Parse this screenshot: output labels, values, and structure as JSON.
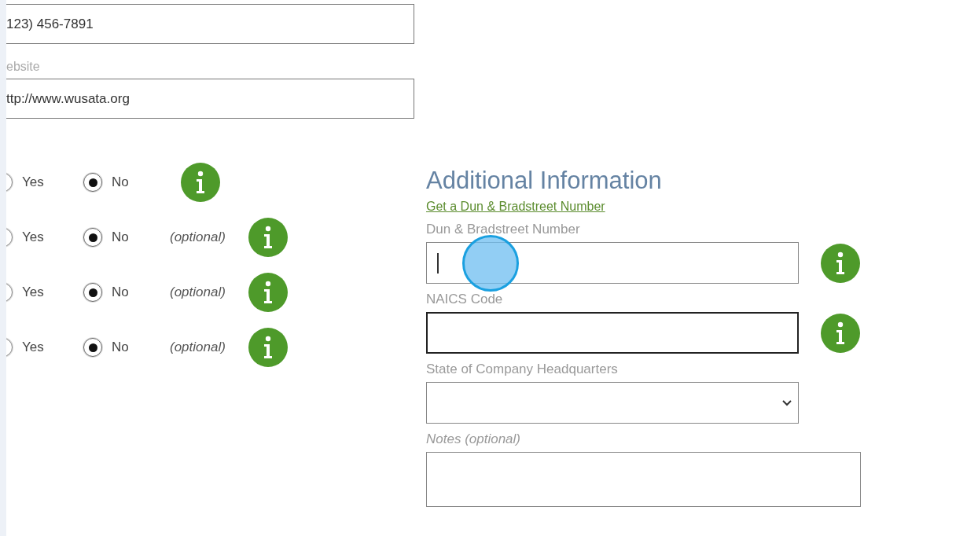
{
  "contact": {
    "phone": {
      "value": "123) 456-7891"
    },
    "website": {
      "label": "ebsite",
      "value": "ttp://www.wusata.org"
    }
  },
  "questions": [
    {
      "options": [
        {
          "label": "Yes",
          "selected": false
        },
        {
          "label": "No",
          "selected": true
        }
      ],
      "info": true
    },
    {
      "options": [
        {
          "label": "Yes",
          "selected": false
        },
        {
          "label": "No",
          "selected": true
        }
      ],
      "note": "(optional)",
      "info": true
    },
    {
      "options": [
        {
          "label": "Yes",
          "selected": false
        },
        {
          "label": "No",
          "selected": true
        }
      ],
      "note": "(optional)",
      "info": true
    },
    {
      "options": [
        {
          "label": "Yes",
          "selected": false
        },
        {
          "label": "No",
          "selected": true
        }
      ],
      "note": "(optional)",
      "info": true
    }
  ],
  "additional": {
    "title": "Additional Information",
    "link": "Get a Dun & Bradstreet Number",
    "fields": [
      {
        "kind": "text",
        "label": "Dun & Bradstreet Number",
        "focused": true,
        "hovered": false,
        "info": true
      },
      {
        "kind": "text",
        "label": "NAICS Code",
        "focused": false,
        "hovered": true,
        "info": true
      },
      {
        "kind": "select",
        "label": "State of Company Headquarters",
        "focused": false,
        "hovered": false,
        "info": false
      },
      {
        "kind": "textarea",
        "label": "Notes (optional)",
        "focused": false,
        "hovered": false,
        "info": false
      }
    ]
  },
  "click_indicator": {
    "visible": true
  }
}
